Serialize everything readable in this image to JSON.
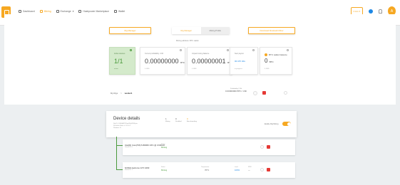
{
  "header": {
    "nav": [
      {
        "label": "Dashboard",
        "icon": "dashboard-icon",
        "active": false
      },
      {
        "label": "Mining",
        "icon": "pickaxe-icon",
        "active": true
      },
      {
        "label": "Exchange",
        "icon": "exchange-icon",
        "active": false
      },
      {
        "label": "Hashpower Marketplace",
        "icon": "marketplace-icon",
        "active": false
      },
      {
        "label": "Wallet",
        "icon": "wallet-icon",
        "active": false
      }
    ],
    "hashrate": "0 H/s ▾",
    "notification_count": "1",
    "avatar_letter": "A"
  },
  "actions": {
    "left_button": "Rig Manager",
    "toggle_on": "Rig Manager",
    "toggle_off": "Mining Profile",
    "right_button": "Download NiceHash Miner"
  },
  "wallet_note": "Mining address: BTC wallet",
  "cards": {
    "active_devices": {
      "label": "Active devices",
      "value": "1/1",
      "sub": "active"
    },
    "profitability": {
      "label": "Current profitability / 24h",
      "value": "0.00000000",
      "unit": "BTC",
      "sub": "0 USD"
    },
    "unpaid": {
      "label": "Unpaid mining balance",
      "value": "0.00000001",
      "unit": "BTC",
      "sub": "0 USD"
    },
    "next_payout": {
      "label": "Next payout",
      "value": "00:47h:40s",
      "sub": "in progress"
    },
    "btc_balance": {
      "label": "BTC wallet balance",
      "value": "0",
      "unit": "BTC",
      "sub": "0 USD"
    }
  },
  "breadcrumb": {
    "root": "My Rigs",
    "separator": ">",
    "current": "worker1"
  },
  "rig_total": {
    "label": "Profitability / 24h",
    "value": "0.00000000 BTC / 24h"
  },
  "device_details": {
    "title": "Device details",
    "meta": [
      "Rig ID: 0-8lrMjA1RVJqaKHjGKNRphw",
      "NiceHash Miner v.1.9.0.6.2",
      "Windows 10"
    ],
    "stats": [
      {
        "value": "1",
        "label": "Mining"
      },
      {
        "value": "0",
        "label": "Disabled"
      },
      {
        "value": "0",
        "label": "Benchmarking"
      }
    ],
    "mining_toggle_label": "Enable Rig Mining"
  },
  "devices": [
    {
      "name": "Intel(R) Core(TM) i5-8600K CPU @ 3.60GHz",
      "sub": "Device ID: 0",
      "status_label": "Status",
      "status": "Mining"
    },
    {
      "name": "NVIDIA GeForce GTX 1060",
      "sub": "Device ID: 1",
      "status_label": "Status",
      "status": "Mining",
      "temp_label": "Temperature",
      "temp": "70°C",
      "load_label": "Load",
      "load": "100%",
      "rpm_label": "RPM",
      "rpm": "—"
    }
  ]
}
